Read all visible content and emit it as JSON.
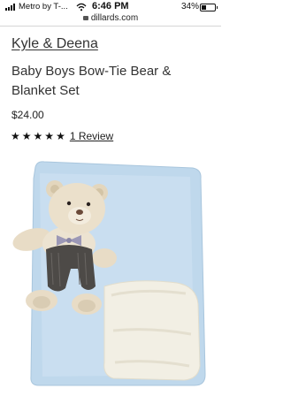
{
  "status_bar": {
    "carrier": "Metro by T-...",
    "time": "6:46 PM",
    "battery_percent": "34%",
    "battery_level": 0.34,
    "url": "dillards.com"
  },
  "product": {
    "brand": "Kyle & Deena",
    "title": "Baby Boys Bow-Tie Bear & Blanket Set",
    "price": "$24.00",
    "rating_stars": 5,
    "reviews_link": "1 Review"
  },
  "icons": {
    "signal": "signal-bars-icon",
    "wifi": "wifi-icon",
    "battery": "battery-icon",
    "lock": "lock-icon",
    "star": "star-icon"
  }
}
